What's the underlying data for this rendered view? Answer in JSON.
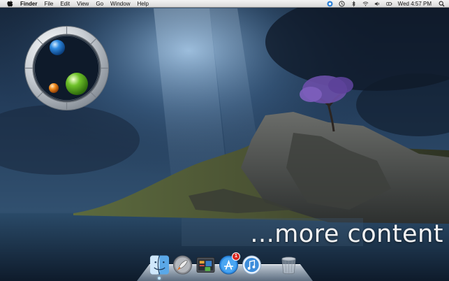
{
  "menubar": {
    "app_name": "Finder",
    "items": [
      "File",
      "Edit",
      "View",
      "Go",
      "Window",
      "Help"
    ],
    "clock": "Wed 4:57 PM"
  },
  "promo": {
    "text": "...more content"
  },
  "dock": {
    "appstore_badge": "1"
  }
}
